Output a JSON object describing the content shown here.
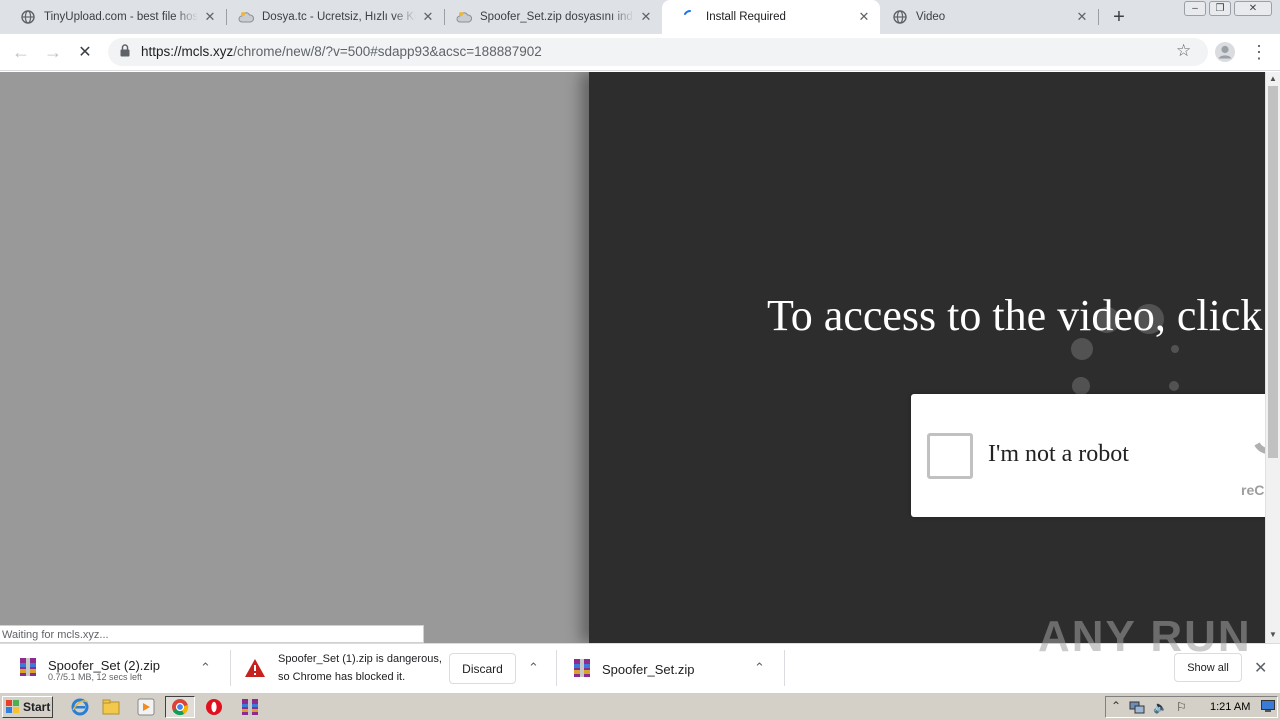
{
  "browser": {
    "tabs": [
      {
        "title": "TinyUpload.com - best file hosting",
        "favicon": "globe-icon",
        "active": false
      },
      {
        "title": "Dosya.tc - Ücretsiz, Hızlı ve Kolay",
        "favicon": "cloud-icon",
        "active": false
      },
      {
        "title": "Spoofer_Set.zip dosyasını indir - Dosya.tc",
        "favicon": "cloud-icon",
        "active": false
      },
      {
        "title": "Install Required",
        "favicon": "loading-spinner-icon",
        "active": true
      },
      {
        "title": "Video",
        "favicon": "globe-icon",
        "active": false
      }
    ],
    "new_tab": "+",
    "window_controls": {
      "minimize": "–",
      "maximize": "❐",
      "close": "✕"
    },
    "toolbar": {
      "back": "←",
      "forward": "→",
      "stop": "✕",
      "url_host": "https://mcls.xyz",
      "url_path": "/chrome/new/8/?v=500#sdapp93&acsc=188887902",
      "star": "☆",
      "menu": "⋮"
    },
    "status_text": "Waiting for mcls.xyz..."
  },
  "page": {
    "headline": "To access to the video, click",
    "captcha": {
      "label": "I'm not a robot",
      "brand": "reCAPTCHA"
    }
  },
  "downloads": {
    "items": [
      {
        "name": "Spoofer_Set (2).zip",
        "progress": "0.7/5.1 MB, 12 secs left",
        "icon": "winrar-archive-icon"
      },
      {
        "warning_line1": "Spoofer_Set (1).zip is dangerous,",
        "warning_line2": "so Chrome has blocked it.",
        "discard_label": "Discard",
        "icon": "warning-icon"
      },
      {
        "name": "Spoofer_Set.zip",
        "icon": "winrar-archive-icon"
      }
    ],
    "show_all": "Show all",
    "close": "✕",
    "watermark": "ANY RUN"
  },
  "taskbar": {
    "start_label": "Start",
    "clock": "1:21 AM",
    "apps": [
      "ie-icon",
      "explorer-icon",
      "media-player-icon",
      "chrome-icon",
      "opera-icon",
      "winrar-icon"
    ]
  },
  "colors": {
    "page_background": "#999999",
    "panel_background": "#2d2d2d",
    "tab_strip": "#dee1e6",
    "taskbar": "#d4d0c8"
  }
}
